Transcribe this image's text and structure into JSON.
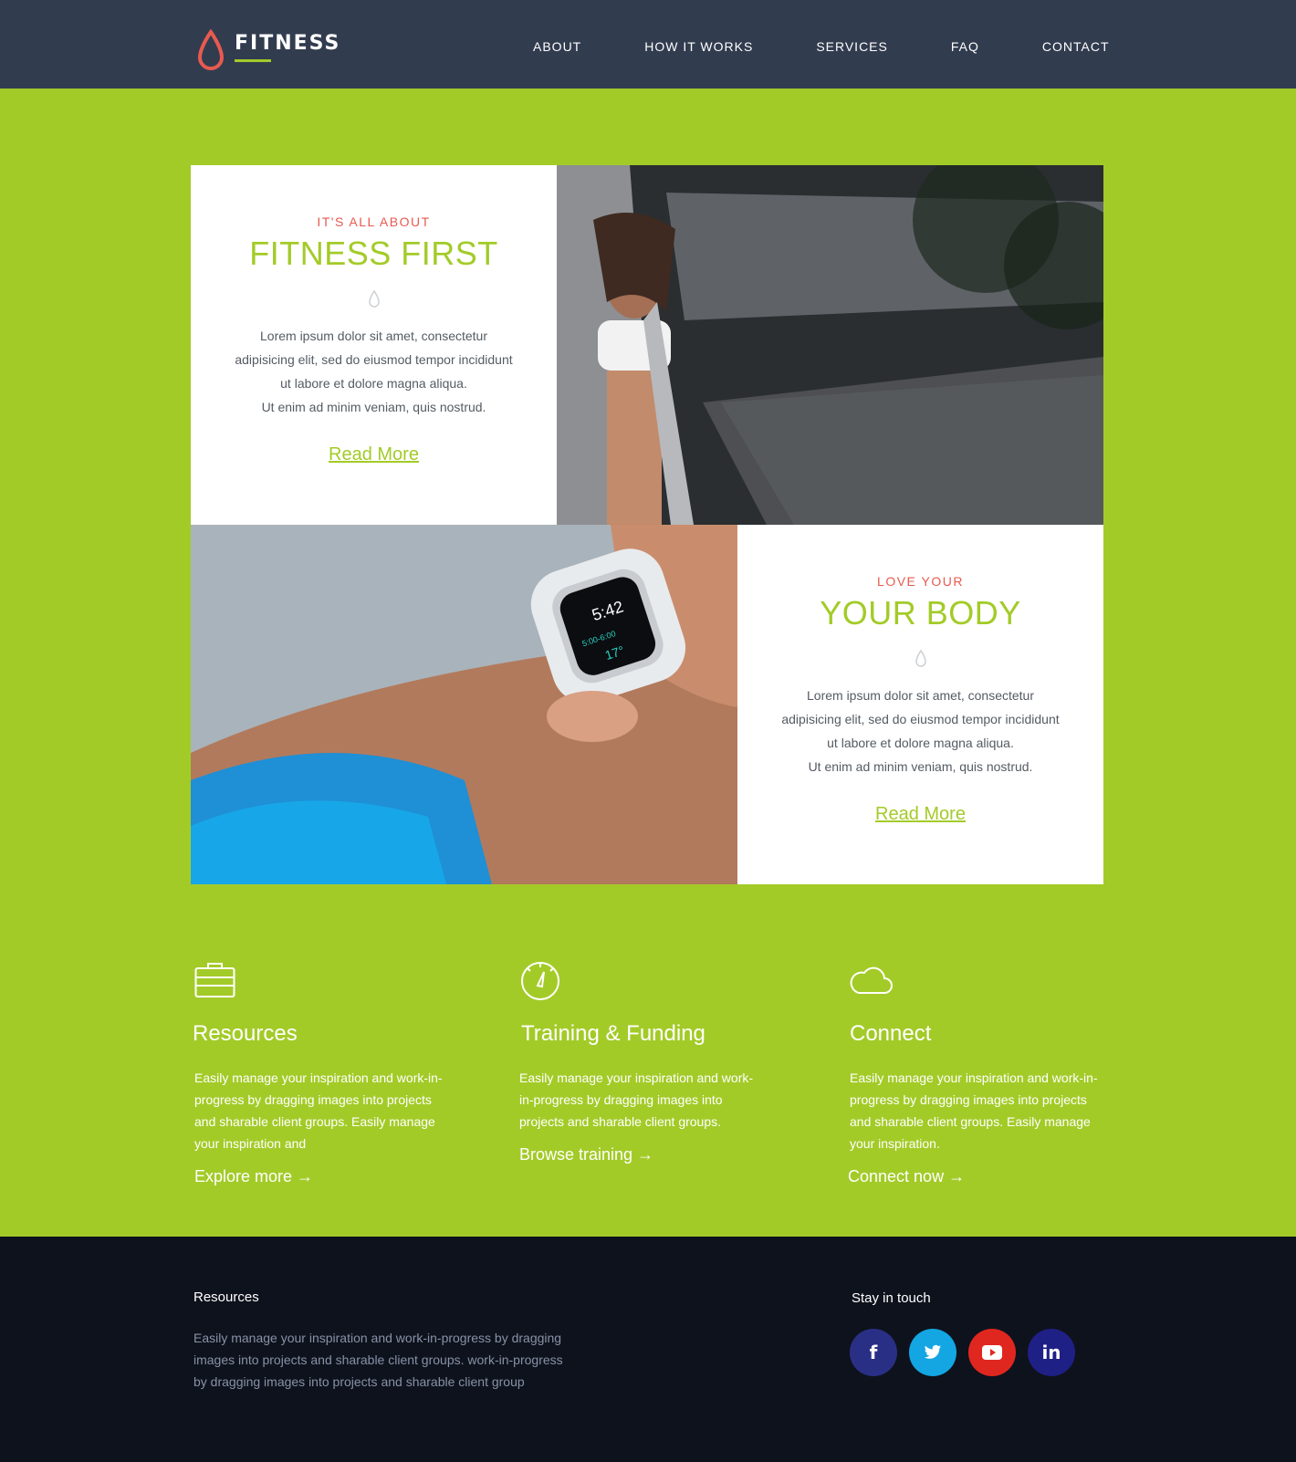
{
  "brand": {
    "name": "FITNESS",
    "accent": "#a3cb28",
    "drop_color": "#e85a4f"
  },
  "nav": [
    "ABOUT",
    "HOW IT WORKS",
    "SERVICES",
    "FAQ",
    "CONTACT"
  ],
  "feature_1": {
    "kicker": "IT'S ALL ABOUT",
    "headline": "FITNESS FIRST",
    "body": [
      "Lorem ipsum dolor sit amet, consectetur",
      "adipisicing elit, sed do eiusmod tempor incididunt",
      "ut labore et dolore magna aliqua.",
      "Ut enim ad minim veniam, quis nostrud."
    ],
    "link": "Read More"
  },
  "feature_2": {
    "kicker": "LOVE YOUR",
    "headline": "YOUR BODY",
    "body": [
      "Lorem ipsum dolor sit amet, consectetur",
      "adipisicing elit, sed do eiusmod tempor incididunt",
      "ut labore et dolore magna aliqua.",
      "Ut enim ad minim veniam, quis nostrud."
    ],
    "link": "Read More"
  },
  "columns": [
    {
      "icon": "briefcase-icon",
      "title": "Resources",
      "text": "Easily manage your inspiration and work-in-progress by dragging images into projects and sharable client groups. Easily manage your inspiration and",
      "link": "Explore more →"
    },
    {
      "icon": "stopwatch-icon",
      "title": "Training & Funding",
      "text": "Easily manage your inspiration and work-in-progress by dragging images into projects and sharable client groups.",
      "link": "Browse training →"
    },
    {
      "icon": "cloud-icon",
      "title": "Connect",
      "text": "Easily manage your inspiration and work-in-progress by dragging images into projects and sharable client groups. Easily manage your inspiration.",
      "link": "Connect now →"
    }
  ],
  "footer": {
    "title": "Resources",
    "text": "Easily manage your inspiration and work-in-progress by dragging images into projects and sharable client groups. work-in-progress by dragging images into projects and sharable client group",
    "stay": "Stay in touch",
    "socials": [
      {
        "icon": "facebook-icon",
        "glyph": "f",
        "color": "#2a2f86"
      },
      {
        "icon": "twitter-icon",
        "glyph": "",
        "color": "#13a6e2"
      },
      {
        "icon": "youtube-icon",
        "glyph": "",
        "color": "#e0271f"
      },
      {
        "icon": "linkedin-icon",
        "glyph": "in",
        "color": "#1f2086"
      }
    ]
  }
}
